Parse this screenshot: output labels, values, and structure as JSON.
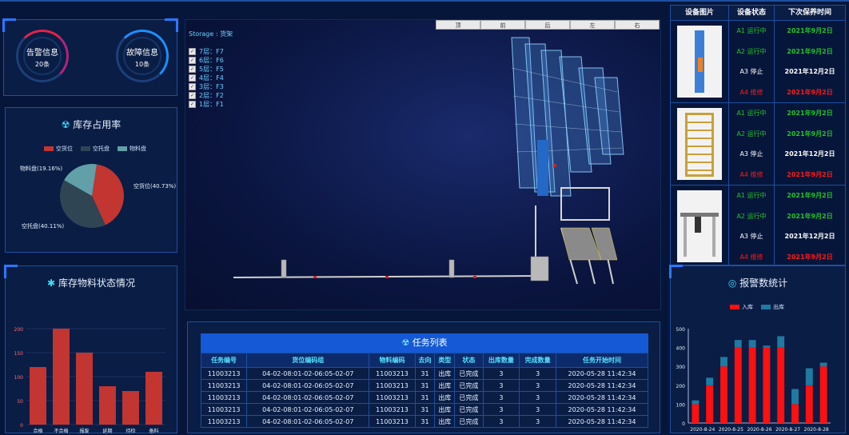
{
  "gauges": [
    {
      "label": "告警信息",
      "value": "20条",
      "color": "#e0234a"
    },
    {
      "label": "故障信息",
      "value": "10条",
      "color": "#1a8fff"
    }
  ],
  "inventory_usage": {
    "title": "库存占用率",
    "legend": [
      {
        "name": "空货位",
        "color": "#c23531"
      },
      {
        "name": "空托盘",
        "color": "#2f4554"
      },
      {
        "name": "物料盘",
        "color": "#61a0a8"
      }
    ]
  },
  "material_status": {
    "title": "库存物料状态情况"
  },
  "storage": {
    "label": "Storage : 货架",
    "layers": [
      "7层：F7",
      "6层：F6",
      "5层：F5",
      "4层：F4",
      "3层：F3",
      "2层：F2",
      "1层：F1"
    ],
    "views": [
      "顶",
      "前",
      "后",
      "左",
      "右"
    ]
  },
  "task_list": {
    "title": "任务列表",
    "headers": [
      "任务编号",
      "货位编码组",
      "物料编码",
      "去向",
      "类型",
      "状态",
      "出库数量",
      "完成数量",
      "任务开始时间"
    ],
    "rows": [
      [
        "11003213",
        "04-02-08:01-02-06:05-02-07",
        "11003213",
        "31",
        "出库",
        "已完成",
        "3",
        "3",
        "2020-05-28 11:42:34"
      ],
      [
        "11003213",
        "04-02-08:01-02-06:05-02-07",
        "11003213",
        "31",
        "出库",
        "已完成",
        "3",
        "3",
        "2020-05-28 11:42:34"
      ],
      [
        "11003213",
        "04-02-08:01-02-06:05-02-07",
        "11003213",
        "31",
        "出库",
        "已完成",
        "3",
        "3",
        "2020-05-28 11:42:34"
      ],
      [
        "11003213",
        "04-02-08:01-02-06:05-02-07",
        "11003213",
        "31",
        "出库",
        "已完成",
        "3",
        "3",
        "2020-05-28 11:42:34"
      ],
      [
        "11003213",
        "04-02-08:01-02-06:05-02-07",
        "11003213",
        "31",
        "出库",
        "已完成",
        "3",
        "3",
        "2020-05-28 11:42:34"
      ]
    ]
  },
  "devices": {
    "headers": [
      "设备图片",
      "设备状态",
      "下次保养时间"
    ],
    "rows": [
      {
        "icon": "vertical-lift-icon",
        "items": [
          {
            "status": "A1 运行中",
            "date": "2021年9月2日",
            "color": "#25c12a"
          },
          {
            "status": "A2 运行中",
            "date": "2021年9月2日",
            "color": "#25c12a"
          },
          {
            "status": "A3 停止",
            "date": "2021年12月2日",
            "color": "#ffffff"
          },
          {
            "status": "A4 维修",
            "date": "2021年9月2日",
            "color": "#ff1a1a"
          }
        ]
      },
      {
        "icon": "rack-lift-icon",
        "items": [
          {
            "status": "A1 运行中",
            "date": "2021年9月2日",
            "color": "#25c12a"
          },
          {
            "status": "A2 运行中",
            "date": "2021年9月2日",
            "color": "#25c12a"
          },
          {
            "status": "A3 停止",
            "date": "2021年12月2日",
            "color": "#ffffff"
          },
          {
            "status": "A4 维修",
            "date": "2021年9月2日",
            "color": "#ff1a1a"
          }
        ]
      },
      {
        "icon": "gantry-robot-icon",
        "items": [
          {
            "status": "A1 运行中",
            "date": "2021年9月2日",
            "color": "#25c12a"
          },
          {
            "status": "A2 运行中",
            "date": "2021年9月2日",
            "color": "#25c12a"
          },
          {
            "status": "A3 停止",
            "date": "2021年12月2日",
            "color": "#ffffff"
          },
          {
            "status": "A4 维修",
            "date": "2021年9月2日",
            "color": "#ff1a1a"
          }
        ]
      }
    ]
  },
  "alarm_stats": {
    "title": "报警数统计"
  },
  "chart_data": [
    {
      "type": "pie",
      "labels": [
        "空货位",
        "空托盘",
        "物料盘"
      ],
      "values": [
        40.73,
        40.11,
        19.16
      ],
      "slice_labels": [
        "空货位(40.73%)",
        "空托盘(40.11%)",
        "物料盘(19.16%)"
      ],
      "colors": [
        "#c23531",
        "#2f4554",
        "#61a0a8"
      ]
    },
    {
      "type": "bar",
      "categories": [
        "合格",
        "不合格",
        "报废",
        "延期",
        "待检",
        "备料"
      ],
      "values": [
        120,
        200,
        150,
        80,
        70,
        110
      ],
      "ylim": [
        0,
        200
      ],
      "yticks": [
        "0",
        "50",
        "100",
        "150",
        "200"
      ],
      "color": "#c23531"
    },
    {
      "type": "bar",
      "stacked": true,
      "legend": [
        "入库",
        "出库"
      ],
      "colors": [
        "#ff1010",
        "#1f7aa0"
      ],
      "x_ticks": [
        "2020-8-24",
        "2020-8-25",
        "2020-8-26",
        "2020-8-27",
        "2020-8-28"
      ],
      "series": [
        {
          "name": "入库",
          "values": [
            100,
            200,
            300,
            400,
            400,
            400,
            400,
            100,
            200,
            300
          ]
        },
        {
          "name": "出库",
          "values": [
            20,
            40,
            50,
            40,
            40,
            10,
            60,
            80,
            90,
            20
          ]
        }
      ],
      "ylim": [
        0,
        500
      ],
      "yticks": [
        "0",
        "100",
        "200",
        "300",
        "400",
        "500"
      ]
    }
  ]
}
